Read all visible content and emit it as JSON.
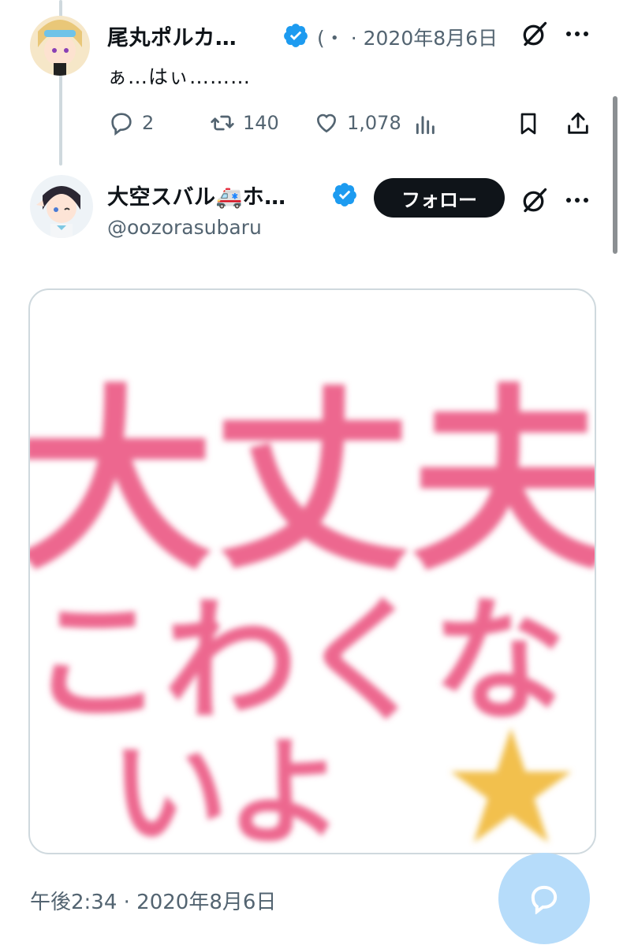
{
  "reply_tweet": {
    "author_name": "尾丸ポルカ…",
    "handle_fragment": "(・",
    "separator": "·",
    "date": "2020年8月6日",
    "text": "ぁ…はぃ………",
    "reply_count": "2",
    "retweet_count": "140",
    "like_count": "1,078"
  },
  "main_tweet": {
    "author_name": "大空スバル🚑ホ…",
    "handle": "@oozorasubaru",
    "follow_label": "フォロー",
    "image_text": {
      "line1": "大丈夫",
      "line2": "こわくな",
      "line3": "いよ",
      "star": "★"
    },
    "timestamp": "午後2:34 · 2020年8月6日"
  },
  "colors": {
    "verified": "#1d9bf0",
    "brush_pink": "#ea4c7b",
    "star_yellow": "#f2c04e",
    "fab": "#b6dcfa"
  },
  "icons": {
    "verified": "verified-badge-icon",
    "grok": "grok-icon",
    "more": "more-icon",
    "reply": "reply-icon",
    "retweet": "retweet-icon",
    "like": "heart-icon",
    "views": "views-icon",
    "bookmark": "bookmark-icon",
    "share": "share-icon",
    "compose": "reply-compose-icon"
  }
}
